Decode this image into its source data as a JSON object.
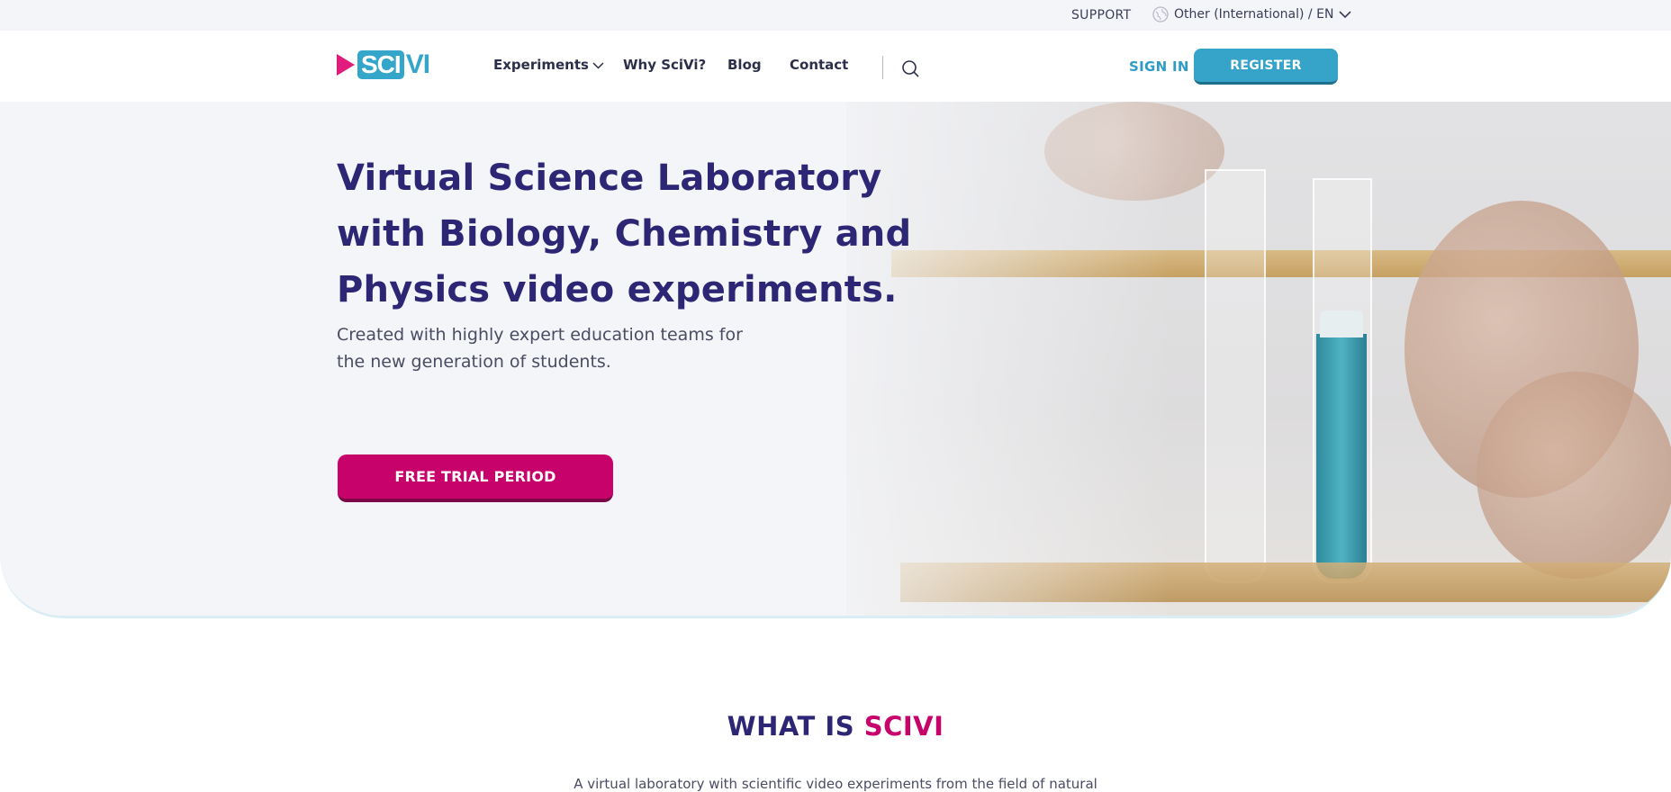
{
  "topbar": {
    "support_label": "SUPPORT",
    "region_label": "Other (International) / EN"
  },
  "header": {
    "logo": {
      "part1": "SCI",
      "part2": "VI"
    },
    "nav": {
      "experiments": "Experiments",
      "why": "Why SciVi?",
      "blog": "Blog",
      "contact": "Contact"
    },
    "signin_label": "SIGN IN",
    "register_label": "REGISTER"
  },
  "hero": {
    "title": "Virtual Science Laboratory with Biology, Chemistry and Physics video experiments.",
    "subtitle": "Created with highly expert education teams for the new generation of students.",
    "cta_label": "FREE TRIAL PERIOD"
  },
  "about": {
    "title_part1": "WHAT IS ",
    "title_part2": "SCIVI",
    "text": "A virtual laboratory with scientific video experiments from the field of natural"
  },
  "colors": {
    "brand_navy": "#2c2675",
    "brand_magenta": "#c7026b",
    "brand_teal": "#36a3c8"
  },
  "icons": [
    "globe-icon",
    "chevron-down-icon",
    "search-icon",
    "play-logo-icon"
  ]
}
